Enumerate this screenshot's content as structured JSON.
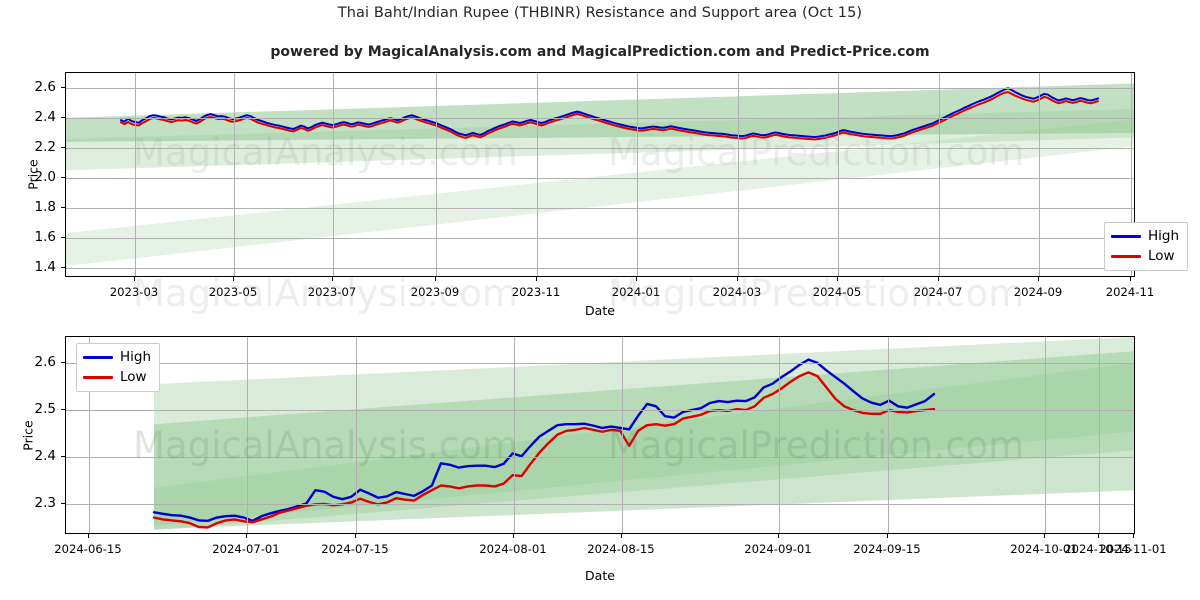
{
  "header": {
    "title": "Thai Baht/Indian Rupee (THBINR) Resistance and Support area (Oct 15)",
    "subtitle": "powered by MagicalAnalysis.com and MagicalPrediction.com and Predict-Price.com"
  },
  "watermarks": {
    "analysis": "MagicalAnalysis.com",
    "prediction": "MagicalPrediction.com"
  },
  "colors": {
    "high": "#0000cc",
    "low": "#dd0000",
    "band_outer": "#b9dab9",
    "band_mid": "#8fc68f",
    "band_inner": "#a9d2a9",
    "grid": "#b0b0b0",
    "axis": "#000000"
  },
  "legend": {
    "items": [
      {
        "label": "High",
        "color": "#0000cc"
      },
      {
        "label": "Low",
        "color": "#dd0000"
      }
    ]
  },
  "chart_data": [
    {
      "id": "overview",
      "type": "line",
      "title": "Thai Baht/Indian Rupee (THBINR) Resistance and Support area (Oct 15)",
      "xlabel": "Date",
      "ylabel": "Price",
      "grid": true,
      "legend_position": "lower right",
      "xlim": [
        "2023-01-20",
        "2024-11-20"
      ],
      "ylim": [
        1.33,
        2.7
      ],
      "yticks": [
        1.4,
        1.6,
        1.8,
        2.0,
        2.2,
        2.4,
        2.6
      ],
      "ytick_labels": [
        "1.4",
        "1.6",
        "1.8",
        "2.0",
        "2.2",
        "2.4",
        "2.6"
      ],
      "xticks": [
        "2023-03",
        "2023-05",
        "2023-07",
        "2023-09",
        "2023-11",
        "2024-01",
        "2024-03",
        "2024-05",
        "2024-07",
        "2024-09",
        "2024-11"
      ],
      "series": [
        {
          "name": "High",
          "color": "#0000cc",
          "values": [
            2.385,
            2.375,
            2.395,
            2.378,
            2.372,
            2.368,
            2.386,
            2.398,
            2.412,
            2.418,
            2.415,
            2.408,
            2.404,
            2.395,
            2.39,
            2.396,
            2.402,
            2.4,
            2.404,
            2.398,
            2.388,
            2.38,
            2.392,
            2.408,
            2.42,
            2.425,
            2.418,
            2.41,
            2.412,
            2.408,
            2.398,
            2.392,
            2.396,
            2.402,
            2.41,
            2.418,
            2.412,
            2.4,
            2.388,
            2.38,
            2.372,
            2.364,
            2.358,
            2.352,
            2.348,
            2.342,
            2.336,
            2.33,
            2.326,
            2.336,
            2.348,
            2.342,
            2.33,
            2.338,
            2.352,
            2.36,
            2.368,
            2.362,
            2.356,
            2.352,
            2.358,
            2.366,
            2.372,
            2.366,
            2.358,
            2.362,
            2.37,
            2.366,
            2.36,
            2.356,
            2.362,
            2.37,
            2.378,
            2.384,
            2.392,
            2.398,
            2.392,
            2.384,
            2.392,
            2.404,
            2.412,
            2.418,
            2.41,
            2.4,
            2.392,
            2.384,
            2.378,
            2.37,
            2.362,
            2.352,
            2.342,
            2.332,
            2.322,
            2.308,
            2.296,
            2.29,
            2.284,
            2.292,
            2.3,
            2.292,
            2.286,
            2.296,
            2.31,
            2.32,
            2.332,
            2.342,
            2.35,
            2.358,
            2.368,
            2.376,
            2.372,
            2.366,
            2.372,
            2.38,
            2.386,
            2.38,
            2.372,
            2.366,
            2.372,
            2.382,
            2.39,
            2.398,
            2.404,
            2.412,
            2.42,
            2.428,
            2.436,
            2.442,
            2.436,
            2.428,
            2.42,
            2.412,
            2.404,
            2.398,
            2.39,
            2.382,
            2.376,
            2.368,
            2.362,
            2.356,
            2.35,
            2.344,
            2.34,
            2.336,
            2.332,
            2.33,
            2.334,
            2.338,
            2.342,
            2.34,
            2.336,
            2.334,
            2.338,
            2.344,
            2.34,
            2.334,
            2.33,
            2.326,
            2.322,
            2.318,
            2.314,
            2.31,
            2.306,
            2.302,
            2.3,
            2.298,
            2.296,
            2.294,
            2.292,
            2.288,
            2.284,
            2.282,
            2.28,
            2.278,
            2.282,
            2.29,
            2.296,
            2.292,
            2.286,
            2.284,
            2.288,
            2.296,
            2.302,
            2.3,
            2.294,
            2.29,
            2.286,
            2.284,
            2.282,
            2.28,
            2.278,
            2.276,
            2.274,
            2.272,
            2.274,
            2.278,
            2.282,
            2.288,
            2.294,
            2.3,
            2.31,
            2.318,
            2.314,
            2.308,
            2.304,
            2.3,
            2.296,
            2.292,
            2.29,
            2.288,
            2.286,
            2.284,
            2.282,
            2.28,
            2.278,
            2.28,
            2.284,
            2.29,
            2.296,
            2.306,
            2.316,
            2.324,
            2.332,
            2.34,
            2.348,
            2.356,
            2.364,
            2.376,
            2.388,
            2.4,
            2.412,
            2.424,
            2.436,
            2.446,
            2.458,
            2.47,
            2.48,
            2.492,
            2.502,
            2.512,
            2.52,
            2.53,
            2.54,
            2.552,
            2.566,
            2.578,
            2.59,
            2.598,
            2.586,
            2.572,
            2.56,
            2.548,
            2.54,
            2.534,
            2.528,
            2.536,
            2.548,
            2.56,
            2.556,
            2.54,
            2.528,
            2.516,
            2.522,
            2.53,
            2.524,
            2.518,
            2.524,
            2.532,
            2.528,
            2.52,
            2.516,
            2.522,
            2.53
          ]
        },
        {
          "name": "Low",
          "color": "#dd0000",
          "values": [
            2.37,
            2.358,
            2.372,
            2.358,
            2.352,
            2.35,
            2.366,
            2.378,
            2.392,
            2.4,
            2.396,
            2.39,
            2.386,
            2.378,
            2.372,
            2.378,
            2.384,
            2.382,
            2.386,
            2.38,
            2.37,
            2.362,
            2.374,
            2.39,
            2.402,
            2.406,
            2.4,
            2.392,
            2.394,
            2.39,
            2.38,
            2.374,
            2.378,
            2.384,
            2.392,
            2.4,
            2.394,
            2.382,
            2.37,
            2.362,
            2.356,
            2.348,
            2.342,
            2.336,
            2.332,
            2.326,
            2.32,
            2.314,
            2.31,
            2.32,
            2.332,
            2.326,
            2.314,
            2.322,
            2.336,
            2.344,
            2.352,
            2.346,
            2.34,
            2.336,
            2.342,
            2.35,
            2.356,
            2.35,
            2.342,
            2.346,
            2.354,
            2.35,
            2.344,
            2.34,
            2.346,
            2.354,
            2.362,
            2.368,
            2.376,
            2.382,
            2.376,
            2.368,
            2.376,
            2.388,
            2.396,
            2.402,
            2.394,
            2.384,
            2.376,
            2.368,
            2.362,
            2.354,
            2.346,
            2.336,
            2.326,
            2.316,
            2.306,
            2.292,
            2.28,
            2.272,
            2.266,
            2.276,
            2.284,
            2.276,
            2.27,
            2.28,
            2.294,
            2.304,
            2.316,
            2.326,
            2.334,
            2.342,
            2.352,
            2.36,
            2.356,
            2.35,
            2.356,
            2.364,
            2.37,
            2.364,
            2.356,
            2.35,
            2.356,
            2.366,
            2.374,
            2.382,
            2.388,
            2.396,
            2.404,
            2.412,
            2.42,
            2.426,
            2.42,
            2.412,
            2.404,
            2.396,
            2.388,
            2.382,
            2.374,
            2.366,
            2.36,
            2.352,
            2.346,
            2.34,
            2.334,
            2.328,
            2.324,
            2.32,
            2.316,
            2.314,
            2.318,
            2.322,
            2.326,
            2.324,
            2.32,
            2.318,
            2.322,
            2.328,
            2.324,
            2.318,
            2.314,
            2.31,
            2.306,
            2.302,
            2.298,
            2.294,
            2.29,
            2.286,
            2.284,
            2.282,
            2.28,
            2.278,
            2.276,
            2.272,
            2.268,
            2.266,
            2.264,
            2.262,
            2.266,
            2.274,
            2.28,
            2.276,
            2.27,
            2.268,
            2.272,
            2.28,
            2.286,
            2.284,
            2.278,
            2.274,
            2.27,
            2.268,
            2.266,
            2.264,
            2.262,
            2.26,
            2.258,
            2.256,
            2.258,
            2.262,
            2.266,
            2.272,
            2.278,
            2.284,
            2.294,
            2.302,
            2.298,
            2.292,
            2.288,
            2.284,
            2.28,
            2.276,
            2.274,
            2.272,
            2.27,
            2.268,
            2.266,
            2.264,
            2.262,
            2.264,
            2.268,
            2.274,
            2.28,
            2.29,
            2.3,
            2.308,
            2.316,
            2.324,
            2.332,
            2.34,
            2.348,
            2.36,
            2.37,
            2.382,
            2.394,
            2.406,
            2.418,
            2.428,
            2.44,
            2.452,
            2.462,
            2.472,
            2.482,
            2.492,
            2.5,
            2.51,
            2.52,
            2.532,
            2.546,
            2.558,
            2.568,
            2.572,
            2.56,
            2.548,
            2.538,
            2.528,
            2.52,
            2.514,
            2.508,
            2.516,
            2.528,
            2.54,
            2.534,
            2.52,
            2.508,
            2.498,
            2.504,
            2.512,
            2.506,
            2.5,
            2.506,
            2.514,
            2.51,
            2.502,
            2.498,
            2.504,
            2.512
          ]
        }
      ],
      "bands": [
        {
          "name": "outer-support",
          "start_low": 1.41,
          "start_high": 1.63,
          "end_low": 2.21,
          "end_high": 2.39,
          "color": "#b9dab9",
          "opacity": 0.35
        },
        {
          "name": "mid-band",
          "start_low": 2.05,
          "start_high": 2.26,
          "end_low": 2.27,
          "end_high": 2.46,
          "color": "#8fc68f",
          "opacity": 0.3
        },
        {
          "name": "resistance-band",
          "start_low": 2.24,
          "start_high": 2.4,
          "end_low": 2.3,
          "end_high": 2.63,
          "color": "#8fc68f",
          "opacity": 0.55
        }
      ]
    },
    {
      "id": "zoom",
      "type": "line",
      "xlabel": "Date",
      "ylabel": "Price",
      "grid": true,
      "legend_position": "upper left",
      "xlim": [
        "2024-06-12",
        "2024-11-05"
      ],
      "ylim": [
        2.235,
        2.655
      ],
      "yticks": [
        2.3,
        2.4,
        2.5,
        2.6
      ],
      "ytick_labels": [
        "2.3",
        "2.4",
        "2.5",
        "2.6"
      ],
      "xticks": [
        "2024-06-15",
        "2024-07-01",
        "2024-07-15",
        "2024-08-01",
        "2024-08-15",
        "2024-09-01",
        "2024-09-15",
        "2024-10-01",
        "2024-10-15",
        "2024-11-01"
      ],
      "series": [
        {
          "name": "High",
          "color": "#0000cc",
          "values": [
            2.283,
            2.28,
            2.277,
            2.276,
            2.272,
            2.266,
            2.265,
            2.272,
            2.275,
            2.276,
            2.272,
            2.265,
            2.275,
            2.281,
            2.286,
            2.29,
            2.296,
            2.302,
            2.33,
            2.327,
            2.316,
            2.311,
            2.316,
            2.331,
            2.323,
            2.314,
            2.317,
            2.326,
            2.322,
            2.318,
            2.328,
            2.34,
            2.387,
            2.384,
            2.378,
            2.381,
            2.382,
            2.382,
            2.379,
            2.386,
            2.408,
            2.402,
            2.424,
            2.444,
            2.456,
            2.468,
            2.47,
            2.47,
            2.471,
            2.467,
            2.462,
            2.465,
            2.462,
            2.459,
            2.488,
            2.513,
            2.508,
            2.487,
            2.484,
            2.496,
            2.5,
            2.504,
            2.515,
            2.519,
            2.517,
            2.52,
            2.519,
            2.527,
            2.548,
            2.556,
            2.57,
            2.582,
            2.596,
            2.607,
            2.6,
            2.584,
            2.57,
            2.556,
            2.54,
            2.525,
            2.516,
            2.511,
            2.52,
            2.508,
            2.505,
            2.512,
            2.519,
            2.534
          ]
        },
        {
          "name": "Low",
          "color": "#dd0000",
          "values": [
            2.272,
            2.268,
            2.266,
            2.264,
            2.26,
            2.252,
            2.251,
            2.26,
            2.266,
            2.268,
            2.264,
            2.262,
            2.268,
            2.274,
            2.282,
            2.287,
            2.292,
            2.297,
            2.3,
            2.301,
            2.298,
            2.3,
            2.304,
            2.312,
            2.305,
            2.3,
            2.304,
            2.313,
            2.31,
            2.308,
            2.32,
            2.33,
            2.34,
            2.338,
            2.334,
            2.338,
            2.34,
            2.34,
            2.338,
            2.344,
            2.362,
            2.36,
            2.386,
            2.41,
            2.43,
            2.448,
            2.456,
            2.458,
            2.462,
            2.458,
            2.454,
            2.458,
            2.456,
            2.424,
            2.456,
            2.468,
            2.47,
            2.467,
            2.47,
            2.482,
            2.486,
            2.49,
            2.498,
            2.5,
            2.498,
            2.502,
            2.5,
            2.508,
            2.526,
            2.534,
            2.546,
            2.56,
            2.572,
            2.58,
            2.572,
            2.548,
            2.524,
            2.508,
            2.5,
            2.494,
            2.492,
            2.492,
            2.5,
            2.496,
            2.495,
            2.498,
            2.5,
            2.502
          ]
        }
      ],
      "bands": [
        {
          "name": "outer-support",
          "start_low": 2.245,
          "start_high": 2.555,
          "end_low": 2.415,
          "end_high": 2.655,
          "color": "#b9dab9",
          "opacity": 0.55
        },
        {
          "name": "mid-band",
          "start_low": 2.247,
          "start_high": 2.47,
          "end_low": 2.33,
          "end_high": 2.625,
          "color": "#8fc68f",
          "opacity": 0.45
        },
        {
          "name": "inner-band",
          "start_low": 2.255,
          "start_high": 2.335,
          "end_low": 2.455,
          "end_high": 2.6,
          "color": "#8fc68f",
          "opacity": 0.3
        }
      ]
    }
  ]
}
